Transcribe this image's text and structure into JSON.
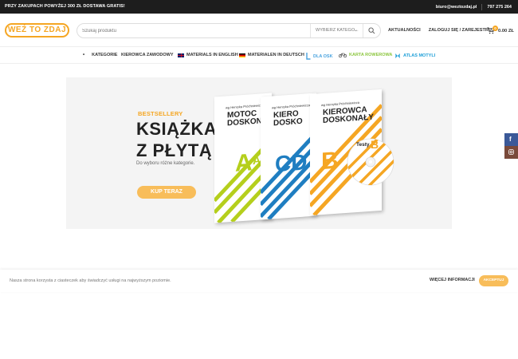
{
  "topbar": {
    "promo": "PRZY ZAKUPACH POWYŻEJ 300 ZŁ DOSTAWA GRATIS!",
    "email": "biuro@weztozdaj.pl",
    "phone": "797 275 264"
  },
  "header": {
    "logo": "WEŹ TO ZDAJ",
    "search_placeholder": "Szukaj produktu",
    "category_select": "WYBIERZ KATEGO...",
    "links": [
      "AKTUALNOŚCI",
      "ZALOGUJ SIĘ / ZAREJESTRUJ"
    ],
    "cart_count": "0",
    "cart_total": "0.00 ZŁ"
  },
  "nav": {
    "items": [
      "KATEGORIE",
      "KIEROWCA ZAWODOWY",
      "MATERIALS IN ENGLISH",
      "MATERIALEN IN DEUTSCH",
      "DLA OSK",
      "KARTA ROWEROWA",
      "ATLAS MOTYLI"
    ],
    "colors": {
      "osk": "#4aa3df",
      "karta": "#8cc63f",
      "atlas": "#1e9fd8"
    }
  },
  "hero": {
    "eyebrow": "BESTSELLERY",
    "title_line1": "KSIĄŻKA",
    "title_line2": "Z PŁYTĄ",
    "subtitle": "Do wyboru różne kategorie.",
    "button": "KUP TERAZ",
    "books": [
      {
        "author": "wg Henryka Próchniewicza",
        "title": [
          "MOTOC",
          "DOSKON"
        ],
        "letters": "A AM",
        "color": "#b5cf1c"
      },
      {
        "author": "wg Henryka Próchniewicza",
        "title": [
          "KIERO",
          "DOSKO"
        ],
        "letters": "CD",
        "color": "#1f7ec1"
      },
      {
        "author": "wg Henryka Próchniewicza",
        "title": [
          "KIEROWCA",
          "DOSKONAŁY"
        ],
        "letters": "B",
        "color": "#f5a623"
      }
    ],
    "disc_label": "Testy",
    "disc_letter": "B"
  },
  "social": {
    "facebook_color": "#3b5998",
    "instagram_color": "#8a3ab9"
  },
  "cookie": {
    "message": "Nasza strona korzysta z ciasteczek aby świadczyć usługi na najwyższym poziomie.",
    "more": "WIĘCEJ INFORMACJI",
    "accept": "AKCEPTUJ"
  },
  "accent": "#f5a623"
}
